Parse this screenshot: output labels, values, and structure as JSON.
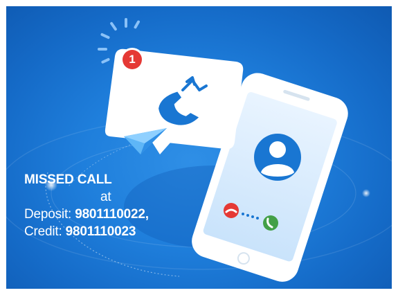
{
  "notification": {
    "badge_count": "1",
    "icon": "missed-call-icon"
  },
  "send_icon": "paper-plane-icon",
  "phone": {
    "contact_icon": "avatar-icon",
    "decline_icon": "decline-call-icon",
    "accept_icon": "accept-call-icon"
  },
  "caption": {
    "headline": "MISSED CALL",
    "connector": "at",
    "deposit_label": "Deposit:",
    "deposit_number": "9801110022,",
    "credit_label": "Credit:",
    "credit_number": "9801110023"
  },
  "colors": {
    "background": "#1f7fdc",
    "badge": "#e53935",
    "accent_blue": "#1976d2",
    "decline": "#e53935",
    "accept": "#43a047"
  }
}
